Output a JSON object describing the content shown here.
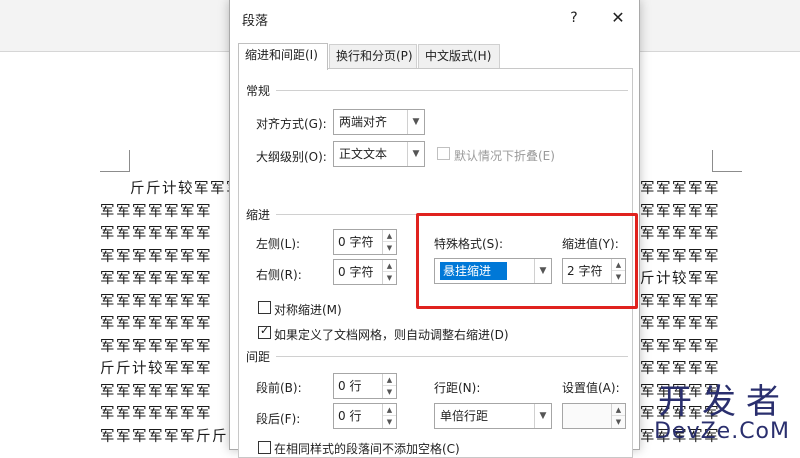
{
  "document": {
    "lines": [
      "斤斤计较军军军",
      "军军军军军军军",
      "军军军军军军军",
      "军军军军军军军",
      "军军军军军军军",
      "军军军军军军军",
      "军军军军军军军",
      "军军军军军军军",
      "斤斤计较军军军",
      "军军军军军军军",
      "军军军军军军军",
      "军军军军军军斤斤"
    ],
    "lines_right": [
      "军军军军军",
      "军军军军军",
      "军军军军军",
      "军军军军军",
      "斤计较军军",
      "军军军军军",
      "军军军军军",
      "军军军军军",
      "军军军军军",
      "军军军军军",
      "军军军军军",
      "军军军军军"
    ]
  },
  "watermark": {
    "top": "开发者",
    "bottom": "DevZe.CoM"
  },
  "dialog": {
    "title": "段落",
    "help": "?",
    "close": "✕",
    "tabs": [
      {
        "label": "缩进和间距(I)",
        "active": true
      },
      {
        "label": "换行和分页(P)",
        "active": false
      },
      {
        "label": "中文版式(H)",
        "active": false
      }
    ],
    "general": {
      "title": "常规",
      "alignment_label": "对齐方式(G):",
      "alignment_value": "两端对齐",
      "outline_label": "大纲级别(O):",
      "outline_value": "正文文本",
      "collapse_label": "默认情况下折叠(E)"
    },
    "indent": {
      "title": "缩进",
      "left_label": "左侧(L):",
      "left_value": "0 字符",
      "right_label": "右侧(R):",
      "right_value": "0 字符",
      "special_label": "特殊格式(S):",
      "special_value": "悬挂缩进",
      "by_label": "缩进值(Y):",
      "by_value": "2 字符",
      "mirror_label": "对称缩进(M)",
      "auto_adjust_label": "如果定义了文档网格，则自动调整右缩进(D)"
    },
    "spacing": {
      "title": "间距",
      "before_label": "段前(B):",
      "before_value": "0 行",
      "after_label": "段后(F):",
      "after_value": "0 行",
      "line_spacing_label": "行距(N):",
      "line_spacing_value": "单倍行距",
      "at_label": "设置值(A):",
      "at_value": "",
      "no_space_label": "在相同样式的段落间不添加空格(C)"
    },
    "highlight_color": "#e0221e",
    "selection_color": "#0078d7"
  }
}
